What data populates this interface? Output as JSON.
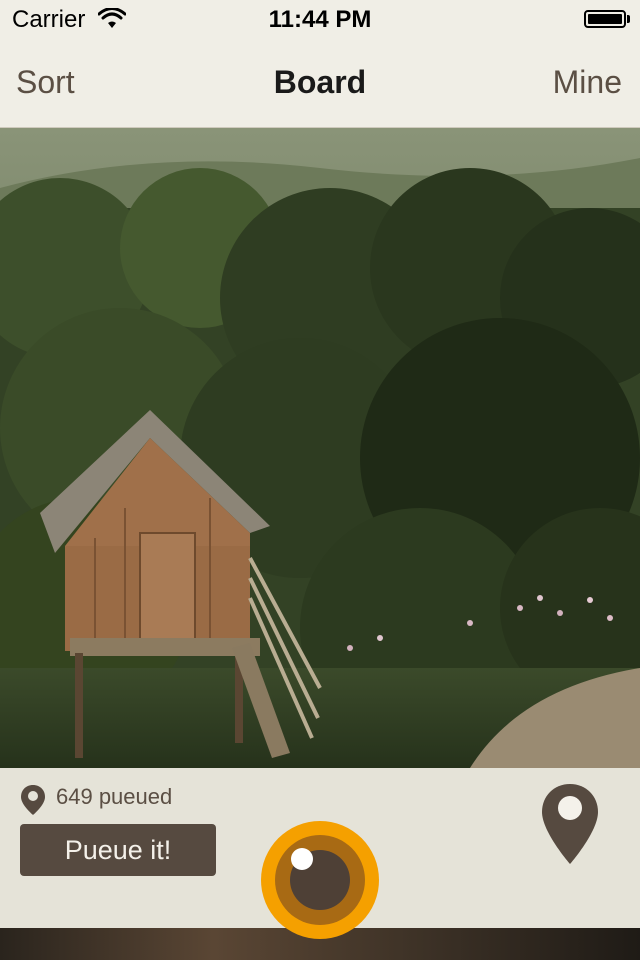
{
  "status_bar": {
    "carrier": "Carrier",
    "time": "11:44 PM"
  },
  "nav": {
    "left": "Sort",
    "title": "Board",
    "right": "Mine"
  },
  "photo": {
    "subject": "wooden-hut-photo"
  },
  "panel": {
    "queued_text": "649 pueued",
    "button_label": "Pueue it!"
  },
  "colors": {
    "brand_brown": "#564a40",
    "accent_orange": "#f5a000",
    "panel_bg": "#e5e3d8",
    "nav_bg": "#f0eee6"
  },
  "icons": [
    "wifi-icon",
    "battery-icon",
    "location-pin-icon",
    "map-pin-icon",
    "camera-shutter-icon"
  ]
}
